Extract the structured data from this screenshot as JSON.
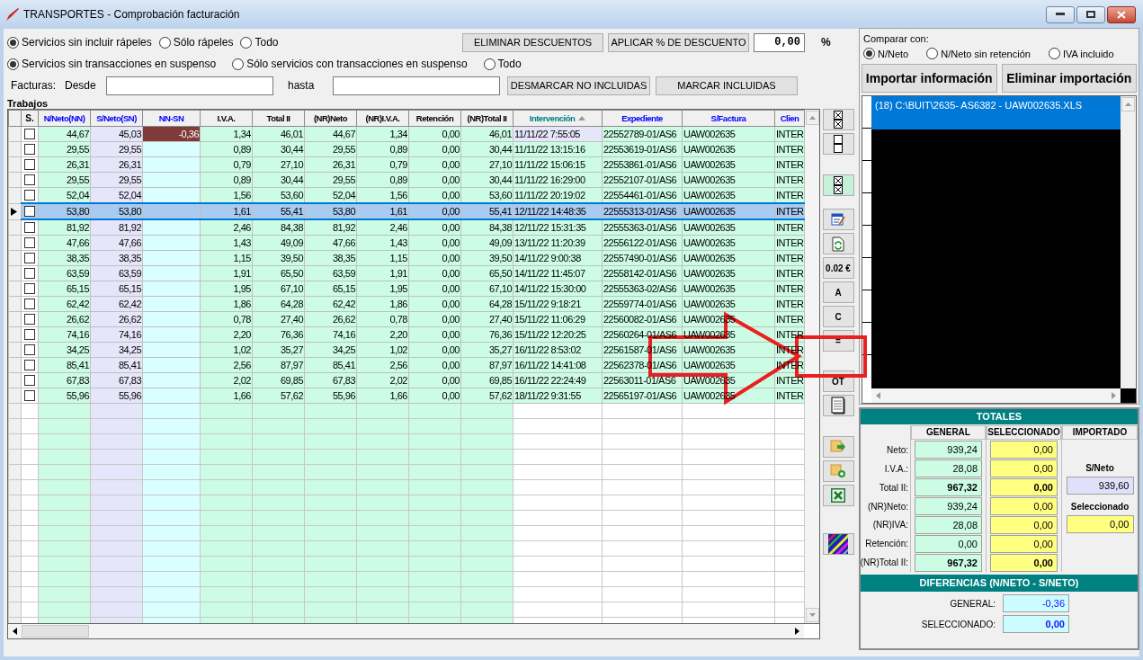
{
  "window": {
    "title": "TRANSPORTES - Comprobación facturación"
  },
  "filters": [
    [
      {
        "label": "Servicios sin incluir rápeles",
        "selected": true
      },
      {
        "label": "Sólo rápeles",
        "selected": false
      },
      {
        "label": "Todo",
        "selected": false
      }
    ],
    [
      {
        "label": "Servicios sin transacciones en suspenso",
        "selected": true
      },
      {
        "label": "Sólo servicios con transacciones en suspenso",
        "selected": false
      },
      {
        "label": "Todo",
        "selected": false
      }
    ]
  ],
  "discount_buttons": [
    "ELIMINAR DESCUENTOS",
    "APLICAR % DE DESCUENTO"
  ],
  "discount": {
    "value": "0,00",
    "unit": "%"
  },
  "invoices": {
    "label": "Facturas:",
    "from_label": "Desde",
    "to_label": "hasta"
  },
  "mark_buttons": [
    "DESMARCAR NO INCLUIDAS",
    "MARCAR INCLUIDAS"
  ],
  "section_title": "Trabajos",
  "table": {
    "checkbox_column": {
      "label": "S."
    },
    "columns": [
      {
        "label": "N/Neto(NN)",
        "color": "#0000ff",
        "sorted": false
      },
      {
        "label": "S/Neto(SN)",
        "color": "#0000ff",
        "sorted": false
      },
      {
        "label": "NN-SN",
        "color": "#0000ff",
        "sorted": false
      },
      {
        "label": "I.V.A.",
        "color": "#000000",
        "sorted": false
      },
      {
        "label": "Total II",
        "color": "#000000",
        "sorted": false
      },
      {
        "label": "(NR)Neto",
        "color": "#000000",
        "sorted": false
      },
      {
        "label": "(NR)I.V.A.",
        "color": "#000000",
        "sorted": false
      },
      {
        "label": "Retención",
        "color": "#000000",
        "sorted": false
      },
      {
        "label": "(NR)Total II",
        "color": "#000000",
        "sorted": false
      },
      {
        "label": "Intervención",
        "color": "#008080",
        "sorted": true
      },
      {
        "label": "Expediente",
        "color": "#0000ff",
        "sorted": false
      },
      {
        "label": "S/Factura",
        "color": "#0000ff",
        "sorted": false
      },
      {
        "label": "Clien",
        "color": "#0000ff",
        "sorted": false
      }
    ],
    "rows": [
      {
        "checked": false,
        "selected": false,
        "cells": [
          "44,67",
          "45,03",
          "-0,36",
          "1,34",
          "46,01",
          "44,67",
          "1,34",
          "0,00",
          "46,01",
          "11/11/22 7:55:05",
          "22552789-01/AS6",
          "UAW002635",
          "INTER"
        ]
      },
      {
        "checked": false,
        "selected": false,
        "cells": [
          "29,55",
          "29,55",
          null,
          "0,89",
          "30,44",
          "29,55",
          "0,89",
          "0,00",
          "30,44",
          "11/11/22 13:15:16",
          "22553619-01/AS6",
          "UAW002635",
          "INTER"
        ]
      },
      {
        "checked": false,
        "selected": false,
        "cells": [
          "26,31",
          "26,31",
          null,
          "0,79",
          "27,10",
          "26,31",
          "0,79",
          "0,00",
          "27,10",
          "11/11/22 15:06:15",
          "22553861-01/AS6",
          "UAW002635",
          "INTER"
        ]
      },
      {
        "checked": false,
        "selected": false,
        "cells": [
          "29,55",
          "29,55",
          null,
          "0,89",
          "30,44",
          "29,55",
          "0,89",
          "0,00",
          "30,44",
          "11/11/22 16:29:00",
          "22552107-01/AS6",
          "UAW002635",
          "INTER"
        ]
      },
      {
        "checked": false,
        "selected": false,
        "cells": [
          "52,04",
          "52,04",
          null,
          "1,56",
          "53,60",
          "52,04",
          "1,56",
          "0,00",
          "53,60",
          "11/11/22 20:19:02",
          "22554461-01/AS6",
          "UAW002635",
          "INTER"
        ]
      },
      {
        "checked": false,
        "selected": true,
        "cells": [
          "53,80",
          "53,80",
          null,
          "1,61",
          "55,41",
          "53,80",
          "1,61",
          "0,00",
          "55,41",
          "12/11/22 14:48:35",
          "22555313-01/AS6",
          "UAW002635",
          "INTER"
        ]
      },
      {
        "checked": false,
        "selected": false,
        "cells": [
          "81,92",
          "81,92",
          null,
          "2,46",
          "84,38",
          "81,92",
          "2,46",
          "0,00",
          "84,38",
          "12/11/22 15:31:35",
          "22555363-01/AS6",
          "UAW002635",
          "INTER"
        ]
      },
      {
        "checked": false,
        "selected": false,
        "cells": [
          "47,66",
          "47,66",
          null,
          "1,43",
          "49,09",
          "47,66",
          "1,43",
          "0,00",
          "49,09",
          "13/11/22 11:20:39",
          "22556122-01/AS6",
          "UAW002635",
          "INTER"
        ]
      },
      {
        "checked": false,
        "selected": false,
        "cells": [
          "38,35",
          "38,35",
          null,
          "1,15",
          "39,50",
          "38,35",
          "1,15",
          "0,00",
          "39,50",
          "14/11/22 9:00:38",
          "22557490-01/AS6",
          "UAW002635",
          "INTER"
        ]
      },
      {
        "checked": false,
        "selected": false,
        "cells": [
          "63,59",
          "63,59",
          null,
          "1,91",
          "65,50",
          "63,59",
          "1,91",
          "0,00",
          "65,50",
          "14/11/22 11:45:07",
          "22558142-01/AS6",
          "UAW002635",
          "INTER"
        ]
      },
      {
        "checked": false,
        "selected": false,
        "cells": [
          "65,15",
          "65,15",
          null,
          "1,95",
          "67,10",
          "65,15",
          "1,95",
          "0,00",
          "67,10",
          "14/11/22 15:30:00",
          "22555363-02/AS6",
          "UAW002635",
          "INTER"
        ]
      },
      {
        "checked": false,
        "selected": false,
        "cells": [
          "62,42",
          "62,42",
          null,
          "1,86",
          "64,28",
          "62,42",
          "1,86",
          "0,00",
          "64,28",
          "15/11/22 9:18:21",
          "22559774-01/AS6",
          "UAW002635",
          "INTER"
        ]
      },
      {
        "checked": false,
        "selected": false,
        "cells": [
          "26,62",
          "26,62",
          null,
          "0,78",
          "27,40",
          "26,62",
          "0,78",
          "0,00",
          "27,40",
          "15/11/22 11:06:29",
          "22560082-01/AS6",
          "UAW002635",
          "INTER"
        ]
      },
      {
        "checked": false,
        "selected": false,
        "cells": [
          "74,16",
          "74,16",
          null,
          "2,20",
          "76,36",
          "74,16",
          "2,20",
          "0,00",
          "76,36",
          "15/11/22 12:20:25",
          "22560264-01/AS6",
          "UAW002635",
          "INTER"
        ]
      },
      {
        "checked": false,
        "selected": false,
        "cells": [
          "34,25",
          "34,25",
          null,
          "1,02",
          "35,27",
          "34,25",
          "1,02",
          "0,00",
          "35,27",
          "16/11/22 8:53:02",
          "22561587-01/AS6",
          "UAW002635",
          "INTER"
        ]
      },
      {
        "checked": false,
        "selected": false,
        "cells": [
          "85,41",
          "85,41",
          null,
          "2,56",
          "87,97",
          "85,41",
          "2,56",
          "0,00",
          "87,97",
          "16/11/22 14:41:08",
          "22562378-01/AS6",
          "UAW002635",
          "INTER"
        ]
      },
      {
        "checked": false,
        "selected": false,
        "cells": [
          "67,83",
          "67,83",
          null,
          "2,02",
          "69,85",
          "67,83",
          "2,02",
          "0,00",
          "69,85",
          "16/11/22 22:24:49",
          "22563011-01/AS6",
          "UAW002635",
          "INTER"
        ]
      },
      {
        "checked": false,
        "selected": false,
        "cells": [
          "55,96",
          "55,96",
          null,
          "1,66",
          "57,62",
          "55,96",
          "1,66",
          "0,00",
          "57,62",
          "18/11/22 9:31:55",
          "22565197-01/AS6",
          "UAW002635",
          "INTER"
        ]
      }
    ]
  },
  "toolbar": [
    [
      {
        "kind": "check-all",
        "active": false
      },
      {
        "kind": "uncheck-all",
        "active": false
      }
    ],
    [
      {
        "kind": "check-all",
        "active": true
      }
    ],
    [
      {
        "kind": "edit",
        "active": false
      },
      {
        "kind": "refresh",
        "active": false
      },
      {
        "kind": "text",
        "label": "0.02 €",
        "active": false
      },
      {
        "kind": "text",
        "label": "A",
        "active": false
      },
      {
        "kind": "text",
        "label": "C",
        "active": false
      },
      {
        "kind": "text",
        "label": "=",
        "active": false
      }
    ],
    [
      {
        "kind": "text",
        "label": "OT",
        "active": false
      },
      {
        "kind": "document",
        "active": false
      }
    ],
    [
      {
        "kind": "export",
        "active": false
      },
      {
        "kind": "add",
        "active": false
      },
      {
        "kind": "excel",
        "active": false
      }
    ],
    [
      {
        "kind": "colors",
        "active": false
      }
    ]
  ],
  "compare": {
    "label": "Comparar con:",
    "options": [
      {
        "label": "N/Neto",
        "selected": true
      },
      {
        "label": "N/Neto sin retención",
        "selected": false
      },
      {
        "label": "IVA incluido",
        "selected": false
      }
    ]
  },
  "import_buttons": [
    "Importar información",
    "Eliminar importación"
  ],
  "import_list": [
    {
      "label": "(18) C:\\BUIT\\2635- AS6382 - UAW002635.XLS",
      "selected": true
    }
  ],
  "totals": {
    "title": "TOTALES",
    "columns": [
      "GENERAL",
      "SELECCIONADO",
      "IMPORTADO"
    ],
    "rows": [
      {
        "label": "Neto:",
        "general": "939,24",
        "selected_value": "0,00",
        "bold": false
      },
      {
        "label": "I.V.A.:",
        "general": "28,08",
        "selected_value": "0,00",
        "bold": false
      },
      {
        "label": "Total II:",
        "general": "967,32",
        "selected_value": "0,00",
        "bold": true
      },
      {
        "label": "(NR)Neto:",
        "general": "939,24",
        "selected_value": "0,00",
        "bold": false
      },
      {
        "label": "(NR)IVA:",
        "general": "28,08",
        "selected_value": "0,00",
        "bold": false
      },
      {
        "label": "Retención:",
        "general": "0,00",
        "selected_value": "0,00",
        "bold": false
      },
      {
        "label": "(NR)Total II:",
        "general": "967,32",
        "selected_value": "0,00",
        "bold": true
      }
    ],
    "imported": [
      {
        "kind": "total",
        "label": "S/Neto",
        "value": "939,60"
      },
      {
        "kind": "selection",
        "label": "Seleccionado",
        "value": "0,00"
      }
    ]
  },
  "differences": {
    "title": "DIFERENCIAS (N/NETO - S/NETO)",
    "rows": [
      {
        "label": "GENERAL:",
        "value": "-0,36",
        "bold": false
      },
      {
        "label": "SELECCIONADO:",
        "value": "0,00",
        "bold": true
      }
    ]
  }
}
